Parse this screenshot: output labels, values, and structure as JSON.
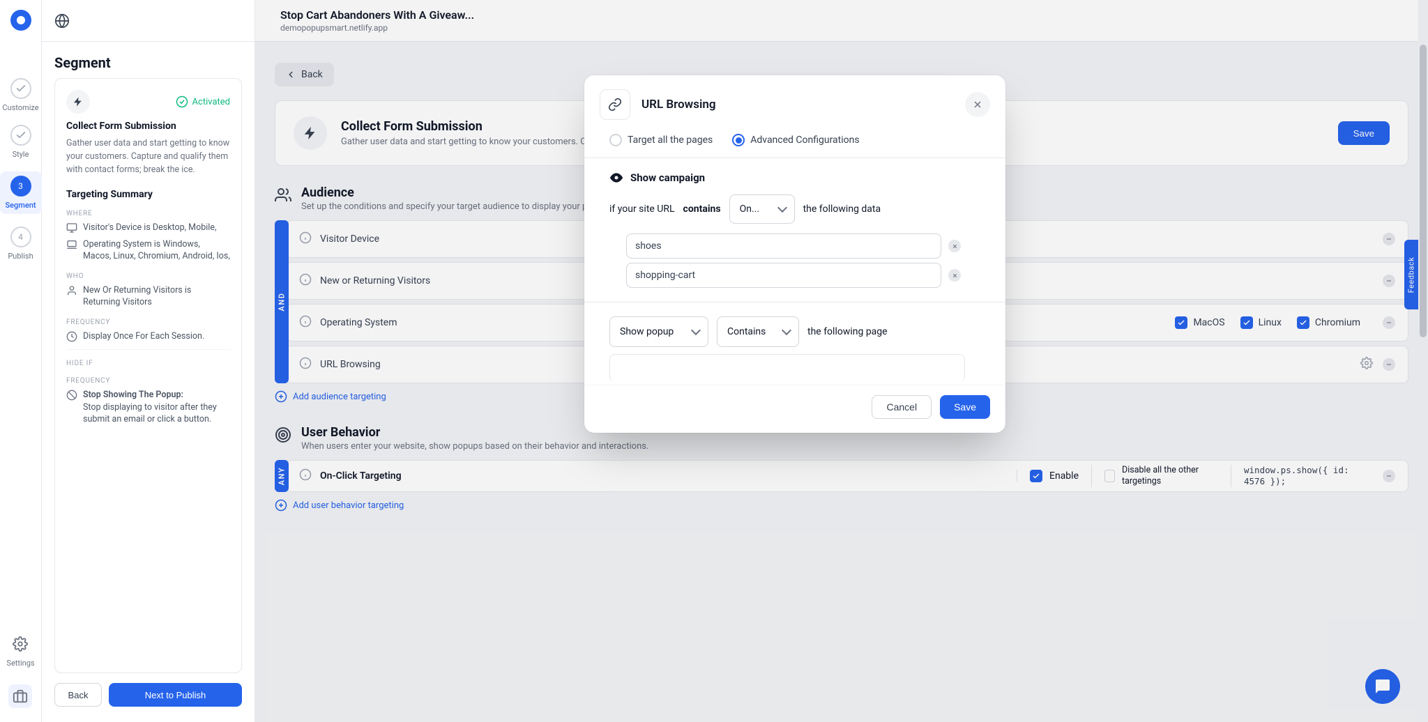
{
  "header": {
    "title": "Stop Cart Abandoners With A Giveaw...",
    "subtitle": "demopopupsmart.netlify.app"
  },
  "rail": {
    "steps": [
      {
        "label": "Customize"
      },
      {
        "label": "Style"
      },
      {
        "num": "3",
        "label": "Segment"
      },
      {
        "num": "4",
        "label": "Publish"
      }
    ],
    "settings": "Settings"
  },
  "panel": {
    "title": "Segment",
    "activated": "Activated",
    "card_title": "Collect Form Submission",
    "card_desc": "Gather user data and start getting to know your customers. Capture and qualify them with contact forms; break the ice.",
    "summary": "Targeting Summary",
    "where": "WHERE",
    "r1": "Visitor's Device is Desktop, Mobile,",
    "r2": "Operating System is Windows, Macos, Linux, Chromium, Android, Ios,",
    "who": "WHO",
    "r3": "New Or Returning Visitors is Returning Visitors",
    "freq": "FREQUENCY",
    "r4": "Display Once For Each Session.",
    "hide": "HIDE IF",
    "freq2": "FREQUENCY",
    "r5_t": "Stop Showing The Popup:",
    "r5_b": "Stop displaying to visitor after they submit an email or click a button.",
    "back": "Back",
    "next": "Next to Publish"
  },
  "main": {
    "back": "Back",
    "hero_title": "Collect Form Submission",
    "hero_desc": "Gather user data and start getting to know your customers. Capture and qualify them with contact forms; break the ice.",
    "save": "Save",
    "aud_title": "Audience",
    "aud_desc": "Set up the conditions and specify your target audience to display your popup on your website.",
    "and": "AND",
    "rows": [
      {
        "label": "Visitor Device"
      },
      {
        "label": "New or Returning Visitors"
      },
      {
        "label": "Operating System"
      },
      {
        "label": "URL Browsing"
      }
    ],
    "os": [
      {
        "label": "MacOS"
      },
      {
        "label": "Linux"
      },
      {
        "label": "Chromium"
      }
    ],
    "add_audience": "Add audience targeting",
    "ub_title": "User Behavior",
    "ub_desc": "When users enter your website, show popups based on their behavior and interactions.",
    "any": "ANY",
    "ub_row": "On-Click Targeting",
    "enable": "Enable",
    "disable": "Disable all the other targetings",
    "code": "window.ps.show({ id: 4576 });",
    "add_ub": "Add user behavior targeting",
    "feedback": "Feedback"
  },
  "modal": {
    "title": "URL Browsing",
    "opt1": "Target all the pages",
    "opt2": "Advanced Configurations",
    "show": "Show campaign",
    "if1a": "if your site URL",
    "if1b": "contains",
    "sel1": "On...",
    "after1": "the following data",
    "tags": [
      "shoes",
      "shopping-cart"
    ],
    "sel2a": "Show popup",
    "sel2b": "Contains",
    "after2": "the following page",
    "cancel": "Cancel",
    "save": "Save"
  }
}
